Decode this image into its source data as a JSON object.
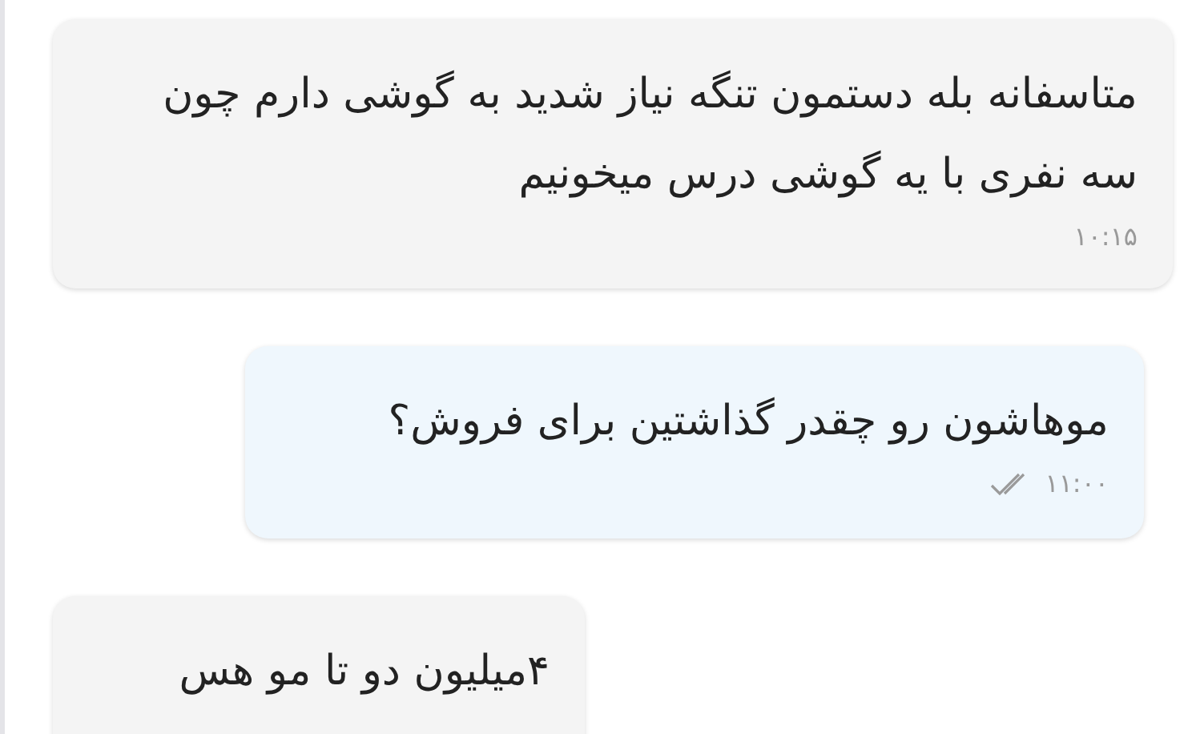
{
  "messages": [
    {
      "kind": "incoming",
      "text": "متاسفانه بله دستمون تنگه نیاز شدید به گوشی دارم چون سه نفری با یه گوشی درس میخونیم",
      "time": "۱۰:۱۵"
    },
    {
      "kind": "outgoing",
      "text": "موهاشون رو چقدر گذاشتین برای فروش؟",
      "time": "۱۱:۰۰",
      "double_checked": true
    },
    {
      "kind": "incoming",
      "text": "۴میلیون دو تا مو هس"
    }
  ]
}
